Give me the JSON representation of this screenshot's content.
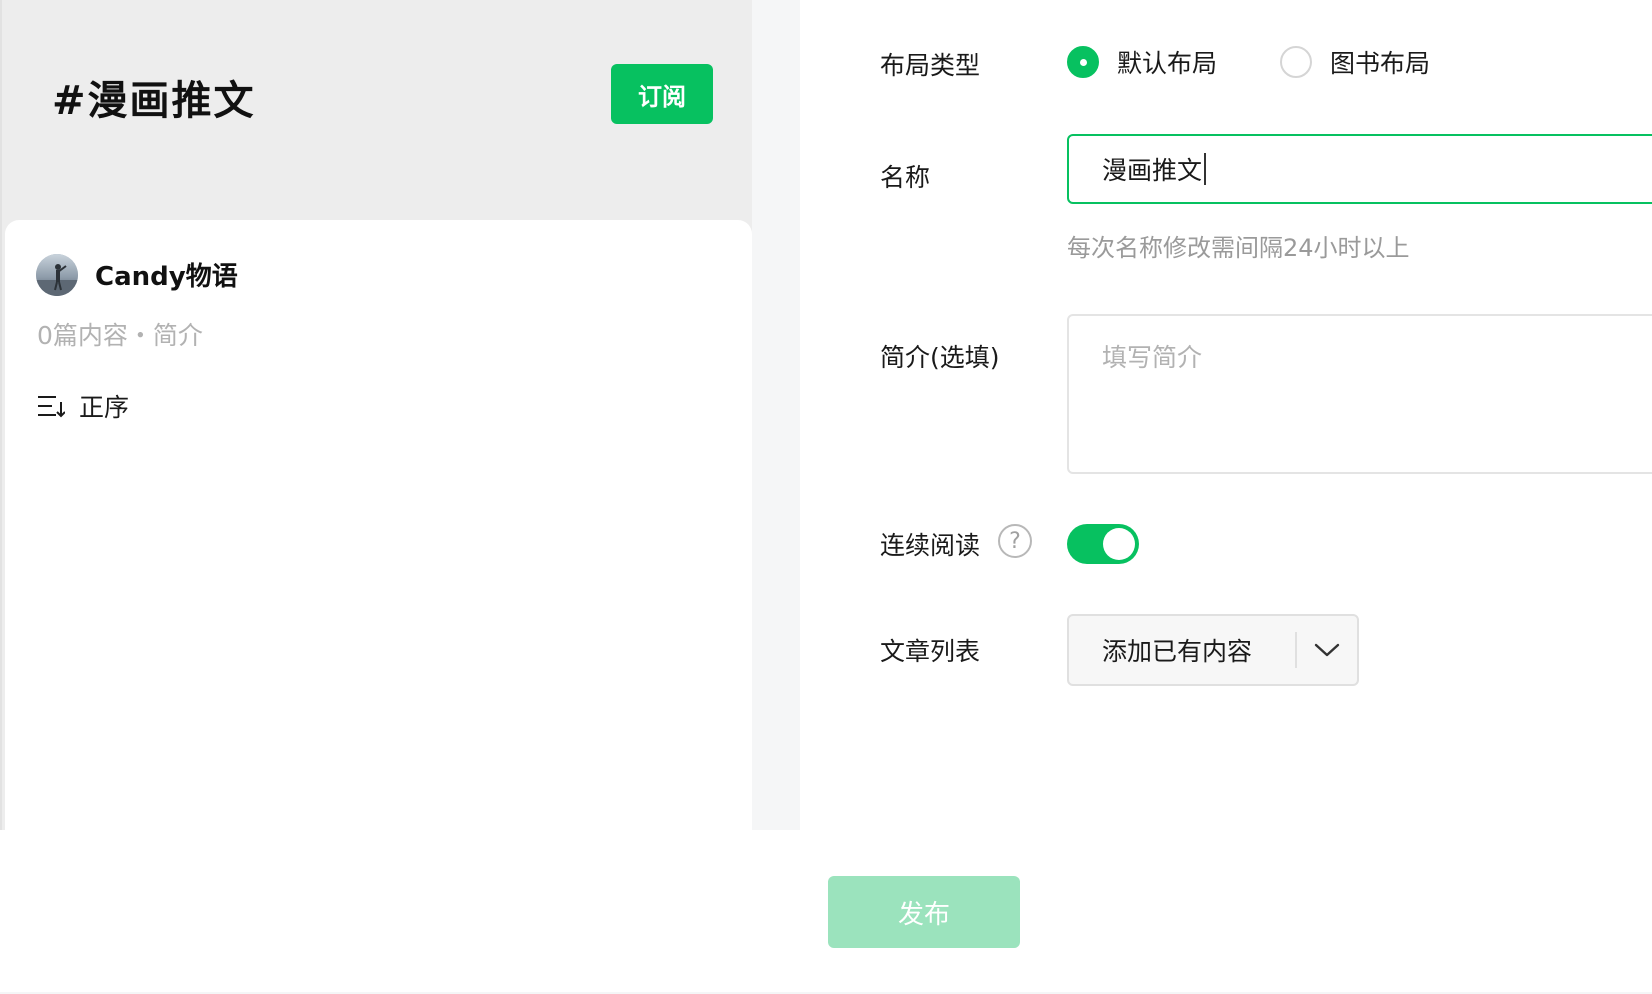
{
  "preview": {
    "topic_title": "#漫画推文",
    "subscribe_label": "订阅",
    "author_name": "Candy物语",
    "meta": "0篇内容・简介",
    "sort_label": "正序"
  },
  "form": {
    "layout_type_label": "布局类型",
    "layout_options": [
      {
        "label": "默认布局",
        "selected": true
      },
      {
        "label": "图书布局",
        "selected": false
      }
    ],
    "name_label": "名称",
    "name_value": "漫画推文",
    "name_hint": "每次名称修改需间隔24小时以上",
    "intro_label": "简介(选填)",
    "intro_placeholder": "填写简介",
    "continuous_label": "连续阅读",
    "help_glyph": "?",
    "continuous_on": true,
    "article_list_label": "文章列表",
    "article_select_label": "添加已有内容"
  },
  "footer": {
    "publish_label": "发布"
  },
  "colors": {
    "accent": "#07c160",
    "accent_disabled": "#9be3bd",
    "muted_text": "#9a9a9a"
  },
  "icons": {
    "sort": "sort-lines-icon",
    "help": "question-circle-icon",
    "dropdown": "chevron-down-icon"
  }
}
